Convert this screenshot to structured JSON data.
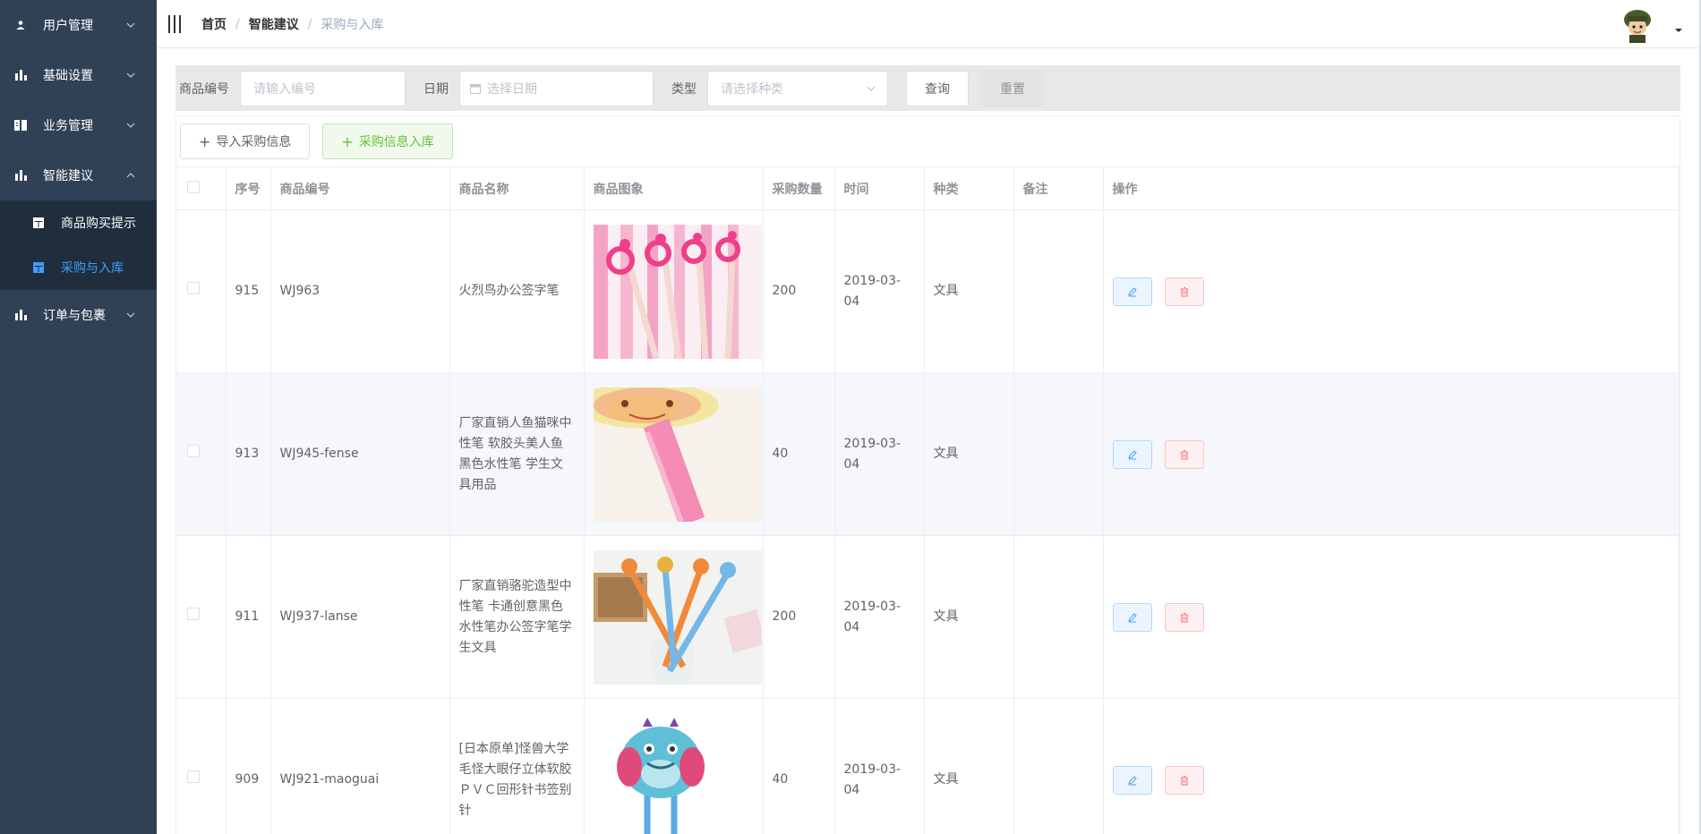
{
  "sidebar": {
    "items": [
      {
        "label": "用户管理",
        "icon": "user-icon",
        "expanded": false
      },
      {
        "label": "基础设置",
        "icon": "bar-chart-icon",
        "expanded": false
      },
      {
        "label": "业务管理",
        "icon": "book-icon",
        "expanded": false
      },
      {
        "label": "智能建议",
        "icon": "bar-chart-icon",
        "expanded": true
      },
      {
        "label": "订单与包裹",
        "icon": "bar-chart-icon",
        "expanded": false
      }
    ],
    "sub_items": [
      {
        "label": "商品购买提示",
        "icon": "table-icon",
        "active": false
      },
      {
        "label": "采购与入库",
        "icon": "table-icon",
        "active": true
      }
    ]
  },
  "header": {
    "breadcrumb": [
      "首页",
      "智能建议",
      "采购与入库"
    ]
  },
  "filter": {
    "code_label": "商品编号",
    "code_placeholder": "请输入编号",
    "date_label": "日期",
    "date_placeholder": "选择日期",
    "type_label": "类型",
    "type_placeholder": "请选择种类",
    "query_label": "查询",
    "reset_label": "重置"
  },
  "toolbar": {
    "import_label": "导入采购信息",
    "stock_in_label": "采购信息入库"
  },
  "table": {
    "columns": [
      "序号",
      "商品编号",
      "商品名称",
      "商品图象",
      "采购数量",
      "时间",
      "种类",
      "备注",
      "操作"
    ],
    "rows": [
      {
        "id": "915",
        "code": "WJ963",
        "name": "火烈鸟办公签字笔",
        "image": "flamingo-pens-image",
        "qty": "200",
        "date": "2019-03-04",
        "type": "文具",
        "note": ""
      },
      {
        "id": "913",
        "code": "WJ945-fense",
        "name": "厂家直销人鱼猫咪中性笔 软胶头美人鱼黑色水性笔 学生文具用品",
        "image": "mermaid-cat-pen-image",
        "qty": "40",
        "date": "2019-03-04",
        "type": "文具",
        "note": ""
      },
      {
        "id": "911",
        "code": "WJ937-lanse",
        "name": "厂家直销骆驼造型中性笔 卡通创意黑色水性笔办公签字笔学生文具",
        "image": "camel-pens-image",
        "qty": "200",
        "date": "2019-03-04",
        "type": "文具",
        "note": ""
      },
      {
        "id": "909",
        "code": "WJ921-maoguai",
        "name": "[日本原单]怪兽大学毛怪大眼仔立体软胶ＰＶＣ回形针书签别针",
        "image": "monster-bookmark-image",
        "qty": "40",
        "date": "2019-03-04",
        "type": "文具",
        "note": ""
      }
    ]
  },
  "colors": {
    "sidebar_bg": "#304156",
    "submenu_bg": "#1f2d3d",
    "active": "#409eff",
    "success": "#67c23a",
    "danger": "#f56c6c"
  }
}
